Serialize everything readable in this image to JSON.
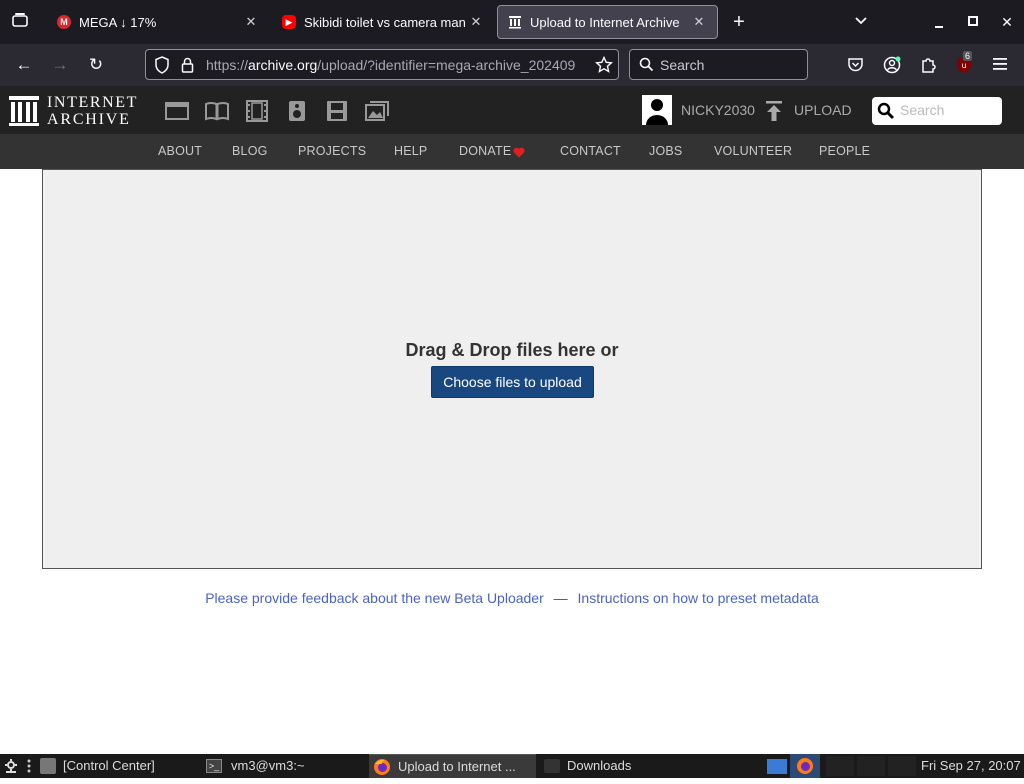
{
  "browser": {
    "tabs": [
      {
        "label": "MEGA ↓ 17%",
        "icon": "mega-icon",
        "color": "#d9272e"
      },
      {
        "label": "Skibidi toilet vs camera man",
        "icon": "youtube-icon",
        "color": "#ff0000"
      },
      {
        "label": "Upload to Internet Archive",
        "icon": "archive-icon",
        "color": "#ffffff"
      }
    ],
    "url_prefix": "https://",
    "url_host": "archive.org",
    "url_path": "/upload/?identifier=mega-archive_202409",
    "search_placeholder": "Search",
    "badge_count": "6"
  },
  "site": {
    "logo_line1": "INTERNET",
    "logo_line2": "ARCHIVE",
    "username": "NICKY2030",
    "upload_label": "UPLOAD",
    "search_placeholder": "Search",
    "nav": [
      "ABOUT",
      "BLOG",
      "PROJECTS",
      "HELP",
      "DONATE",
      "CONTACT",
      "JOBS",
      "VOLUNTEER",
      "PEOPLE"
    ],
    "accent": "#194880"
  },
  "main": {
    "drop_title": "Drag & Drop files here or",
    "choose_button": "Choose files to upload",
    "feedback_link": "Please provide feedback about the new Beta Uploader",
    "separator": "—",
    "instructions_link": "Instructions on how to preset metadata"
  },
  "taskbar": {
    "control_center": "[Control Center]",
    "terminal": "vm3@vm3:~",
    "firefox_task": "Upload to Internet ...",
    "downloads": "Downloads",
    "clock": "Fri Sep 27, 20:07"
  }
}
